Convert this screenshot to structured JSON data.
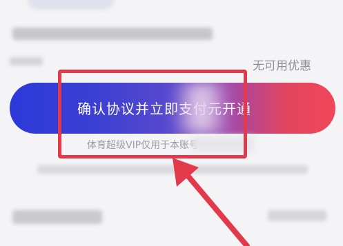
{
  "coupon": {
    "status_text": "无可用优惠"
  },
  "cta": {
    "label": "确认协议并立即支付元开通"
  },
  "note": {
    "text": "体育超级VIP仅用于本账号"
  },
  "annotation": {
    "color": "#e23a4a"
  }
}
